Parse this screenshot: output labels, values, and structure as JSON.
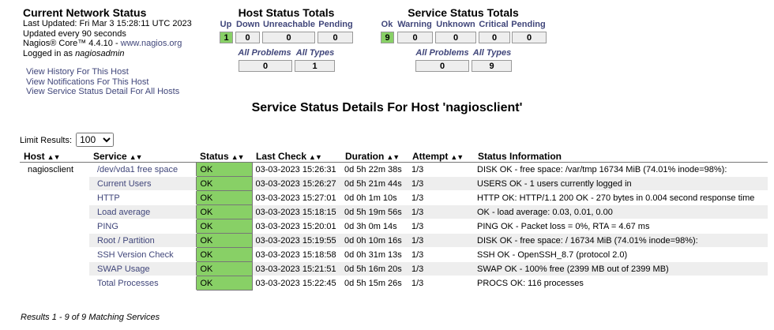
{
  "info": {
    "title": "Current Network Status",
    "last_updated": "Last Updated: Fri Mar 3 15:28:11 UTC 2023",
    "updated_every": "Updated every 90 seconds",
    "version_prefix": "Nagios® Core™ 4.4.10 - ",
    "version_link": "www.nagios.org",
    "logged_in_prefix": "Logged in as ",
    "user": "nagiosadmin"
  },
  "nav_links": [
    "View History For This Host",
    "View Notifications For This Host",
    "View Service Status Detail For All Hosts"
  ],
  "host_totals": {
    "title": "Host Status Totals",
    "headers": [
      "Up",
      "Down",
      "Unreachable",
      "Pending"
    ],
    "values": [
      "1",
      "0",
      "0",
      "0"
    ],
    "all_problems_label": "All Problems",
    "all_types_label": "All Types",
    "all_problems": "0",
    "all_types": "1"
  },
  "service_totals": {
    "title": "Service Status Totals",
    "headers": [
      "Ok",
      "Warning",
      "Unknown",
      "Critical",
      "Pending"
    ],
    "values": [
      "9",
      "0",
      "0",
      "0",
      "0"
    ],
    "all_problems_label": "All Problems",
    "all_types_label": "All Types",
    "all_problems": "0",
    "all_types": "9"
  },
  "page_heading": "Service Status Details For Host 'nagiosclient'",
  "limit": {
    "label": "Limit Results:",
    "value": "100"
  },
  "table": {
    "headers": [
      "Host",
      "Service",
      "Status",
      "Last Check",
      "Duration",
      "Attempt",
      "Status Information"
    ],
    "host": "nagiosclient",
    "rows": [
      {
        "service": "/dev/vda1 free space",
        "status": "OK",
        "last_check": "03-03-2023 15:26:31",
        "duration": "0d 5h 22m 38s",
        "attempt": "1/3",
        "info": "DISK OK - free space: /var/tmp 16734 MiB (74.01% inode=98%):"
      },
      {
        "service": "Current Users",
        "status": "OK",
        "last_check": "03-03-2023 15:26:27",
        "duration": "0d 5h 21m 44s",
        "attempt": "1/3",
        "info": "USERS OK - 1 users currently logged in"
      },
      {
        "service": "HTTP",
        "status": "OK",
        "last_check": "03-03-2023 15:27:01",
        "duration": "0d 0h 1m 10s",
        "attempt": "1/3",
        "info": "HTTP OK: HTTP/1.1 200 OK - 270 bytes in 0.004 second response time"
      },
      {
        "service": "Load average",
        "status": "OK",
        "last_check": "03-03-2023 15:18:15",
        "duration": "0d 5h 19m 56s",
        "attempt": "1/3",
        "info": "OK - load average: 0.03, 0.01, 0.00"
      },
      {
        "service": "PING",
        "status": "OK",
        "last_check": "03-03-2023 15:20:01",
        "duration": "0d 3h 0m 14s",
        "attempt": "1/3",
        "info": "PING OK - Packet loss = 0%, RTA = 4.67 ms"
      },
      {
        "service": "Root / Partition",
        "status": "OK",
        "last_check": "03-03-2023 15:19:55",
        "duration": "0d 0h 10m 16s",
        "attempt": "1/3",
        "info": "DISK OK - free space: / 16734 MiB (74.01% inode=98%):"
      },
      {
        "service": "SSH Version Check",
        "status": "OK",
        "last_check": "03-03-2023 15:18:58",
        "duration": "0d 0h 31m 13s",
        "attempt": "1/3",
        "info": "SSH OK - OpenSSH_8.7 (protocol 2.0)"
      },
      {
        "service": "SWAP Usage",
        "status": "OK",
        "last_check": "03-03-2023 15:21:51",
        "duration": "0d 5h 16m 20s",
        "attempt": "1/3",
        "info": "SWAP OK - 100% free (2399 MB out of 2399 MB)"
      },
      {
        "service": "Total Processes",
        "status": "OK",
        "last_check": "03-03-2023 15:22:45",
        "duration": "0d 5h 15m 26s",
        "attempt": "1/3",
        "info": "PROCS OK: 116 processes"
      }
    ]
  },
  "footer": "Results 1 - 9 of 9 Matching Services",
  "colors": {
    "ok_green": "#88d066",
    "link": "#40467a",
    "row_alt": "#eeeeee"
  }
}
